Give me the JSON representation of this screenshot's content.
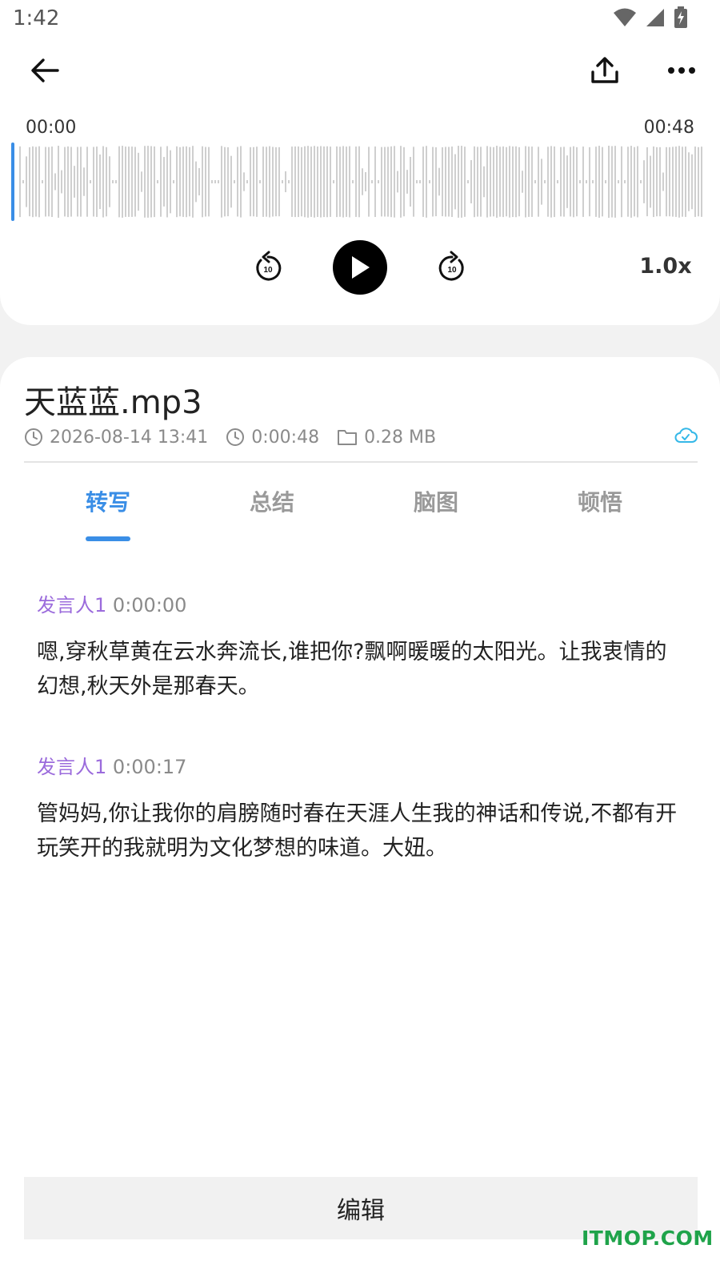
{
  "status_bar": {
    "time": "1:42"
  },
  "player": {
    "time_start": "00:00",
    "time_end": "00:48",
    "skip_back_seconds": "10",
    "skip_forward_seconds": "10",
    "speed": "1.0x",
    "progress": 0.0
  },
  "file": {
    "title": "天蓝蓝.mp3",
    "date": "2026-08-14 13:41",
    "duration": "0:00:48",
    "size": "0.28 MB"
  },
  "tabs": [
    {
      "label": "转写",
      "active": true
    },
    {
      "label": "总结",
      "active": false
    },
    {
      "label": "脑图",
      "active": false
    },
    {
      "label": "顿悟",
      "active": false
    }
  ],
  "transcript": [
    {
      "speaker": "发言人1",
      "time": "0:00:00",
      "text": "嗯,穿秋草黄在云水奔流长,谁把你?飘啊暖暖的太阳光。让我衷情的幻想,秋天外是那春天。"
    },
    {
      "speaker": "发言人1",
      "time": "0:00:17",
      "text": "管妈妈,你让我你的肩膀随时春在天涯人生我的神话和传说,不都有开玩笑开的我就明为文化梦想的味道。大妞。"
    }
  ],
  "edit_label": "编辑",
  "watermark": "ITMOP.COM",
  "colors": {
    "accent": "#3a8ee6",
    "speaker": "#9b6bdc",
    "cloud": "#35b8e8",
    "watermark": "#1fa34a"
  }
}
